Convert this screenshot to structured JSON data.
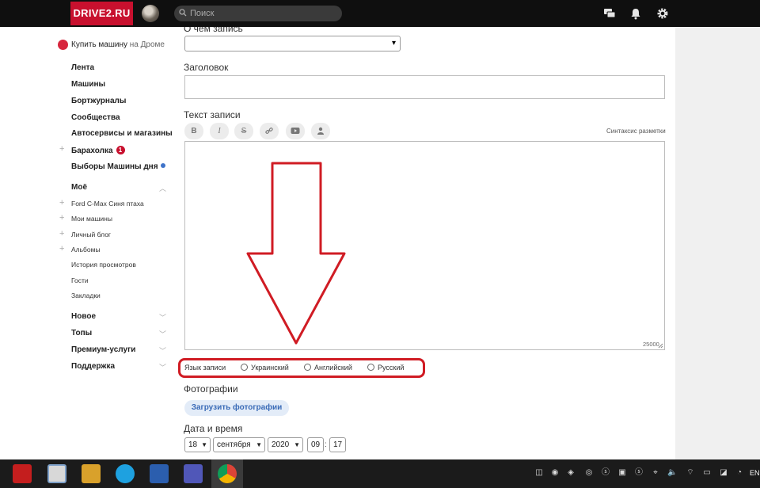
{
  "brand": {
    "logo_text": "DRIVE2.RU",
    "red": "#c8102e"
  },
  "header": {
    "search_placeholder": "Поиск",
    "icons": [
      "chat-icon",
      "bell-icon",
      "gear-icon"
    ]
  },
  "sidebar": {
    "promo": {
      "bold": "Купить машину",
      "rest": " на Дроме"
    },
    "main_items": [
      {
        "label": "Лента"
      },
      {
        "label": "Машины"
      },
      {
        "label": "Бортжурналы"
      },
      {
        "label": "Сообщества"
      },
      {
        "label": "Автосервисы и магазины"
      }
    ],
    "baraholka": {
      "label": "Барахолка",
      "badge": "1"
    },
    "vybory": {
      "label": "Выборы Машины дня"
    },
    "moe": {
      "title": "Моё",
      "items": [
        {
          "label": "Ford C-Max Синя птаха"
        },
        {
          "label": "Мои машины"
        },
        {
          "label": "Личный блог"
        },
        {
          "label": "Альбомы"
        },
        {
          "label": "История просмотров"
        },
        {
          "label": "Гости"
        },
        {
          "label": "Закладки"
        }
      ]
    },
    "groups": [
      {
        "label": "Новое"
      },
      {
        "label": "Топы"
      },
      {
        "label": "Премиум-услуги"
      },
      {
        "label": "Поддержка"
      }
    ]
  },
  "form": {
    "subject_label": "О чем запись",
    "subject_value": "",
    "title_label": "Заголовок",
    "title_value": "",
    "text_label": "Текст записи",
    "toolbar": {
      "bold": "B",
      "italic": "I",
      "strike": "S",
      "icons": [
        "link-icon",
        "video-icon",
        "user-icon"
      ]
    },
    "syntax_link": "Синтаксис разметки",
    "char_counter": "25000",
    "language": {
      "label": "Язык записи",
      "options": [
        {
          "label": "Украинский",
          "selected": false
        },
        {
          "label": "Английский",
          "selected": false
        },
        {
          "label": "Русский",
          "selected": false
        }
      ]
    },
    "photos_label": "Фотографии",
    "upload_button": "Загрузить фотографии",
    "datetime_label": "Дата и время",
    "date": {
      "day": "18",
      "month": "сентября",
      "year": "2020",
      "hour": "09",
      "minute": "17"
    }
  },
  "annotation": {
    "color": "#d01c24"
  },
  "taskbar": {
    "apps": [
      "mc-icon",
      "notepad-icon",
      "game-icon",
      "skype-icon",
      "word-icon",
      "teams-icon",
      "chrome-icon"
    ],
    "language": "EN"
  }
}
